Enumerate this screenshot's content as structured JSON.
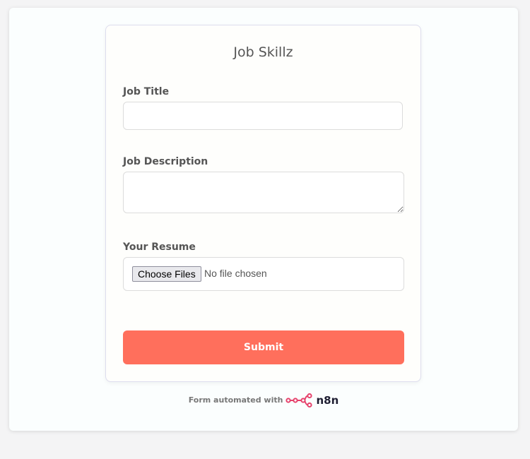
{
  "form": {
    "title": "Job Skillz",
    "fields": [
      {
        "label": "Job Title",
        "value": "",
        "placeholder": ""
      },
      {
        "label": "Job Description",
        "value": "",
        "placeholder": ""
      },
      {
        "label": "Your Resume",
        "button_label": "Choose Files",
        "status": "No file chosen"
      }
    ],
    "submit_label": "Submit"
  },
  "footer": {
    "text": "Form automated with",
    "brand": "n8n",
    "brand_icon": "n8n-logo-icon"
  },
  "colors": {
    "accent": "#ff6f5c",
    "brand_logo": "#e6416b"
  }
}
